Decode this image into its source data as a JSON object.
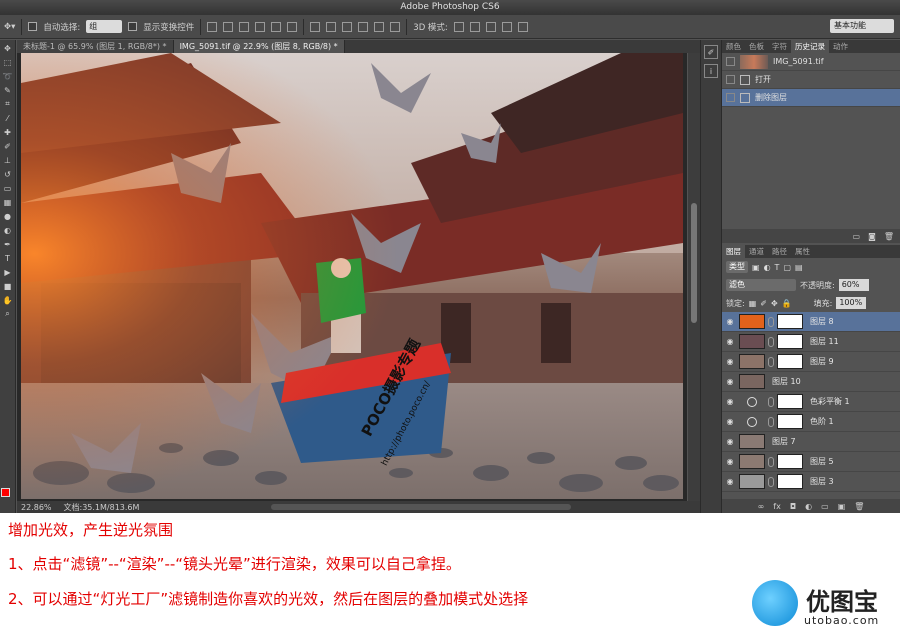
{
  "app": {
    "title": "Adobe Photoshop CS6"
  },
  "options_bar": {
    "auto_select_label": "自动选择:",
    "auto_select_value": "组",
    "show_transform_label": "显示变换控件",
    "mode_3d_label": "3D 模式:",
    "workspace": "基本功能"
  },
  "document_tabs": [
    {
      "label": "未标题-1 @ 65.9% (图层 1, RGB/8*) *",
      "active": false
    },
    {
      "label": "IMG_5091.tif @ 22.9% (图层 8, RGB/8) *",
      "active": true
    }
  ],
  "status": {
    "zoom": "22.86%",
    "doc": "文档:35.1M/813.6M"
  },
  "history_panel": {
    "tabs": [
      "颜色",
      "色板",
      "字符",
      "历史记录",
      "动作"
    ],
    "active_tab": "历史记录",
    "snapshot": "IMG_5091.tif",
    "steps": [
      {
        "label": "打开",
        "selected": false
      },
      {
        "label": "删除图层",
        "selected": true
      }
    ]
  },
  "layers_panel": {
    "tabs": [
      "图层",
      "通道",
      "路径",
      "属性"
    ],
    "active_tab": "图层",
    "filter_kind": "类型",
    "blend_mode": "滤色",
    "opacity_label": "不透明度:",
    "opacity": "60%",
    "lock_label": "锁定:",
    "fill_label": "填充:",
    "fill": "100%",
    "layers": [
      {
        "name": "图层 8",
        "selected": true,
        "thumb": "#e2621c",
        "mask": true,
        "adjustment": false
      },
      {
        "name": "图层 11",
        "selected": false,
        "thumb": "#6a4d52",
        "mask": true,
        "adjustment": false
      },
      {
        "name": "图层 9",
        "selected": false,
        "thumb": "#8c7368",
        "mask": true,
        "adjustment": false
      },
      {
        "name": "图层 10",
        "selected": false,
        "thumb": "#7a6660",
        "mask": false,
        "adjustment": false
      },
      {
        "name": "色彩平衡 1",
        "selected": false,
        "thumb": "",
        "mask": true,
        "adjustment": true
      },
      {
        "name": "色阶 1",
        "selected": false,
        "thumb": "",
        "mask": true,
        "adjustment": true
      },
      {
        "name": "图层 7",
        "selected": false,
        "thumb": "#8a7a74",
        "mask": false,
        "adjustment": false
      },
      {
        "name": "图层 5",
        "selected": false,
        "thumb": "#8c7a72",
        "mask": true,
        "adjustment": false
      },
      {
        "name": "图层 3",
        "selected": false,
        "thumb": "#9a9a9a",
        "mask": true,
        "adjustment": false
      }
    ]
  },
  "tutorial": {
    "line1": "增加光效，产生逆光氛围",
    "line2": "1、点击“滤镜”--“渲染”--“镜头光晕”进行渲染，效果可以自己拿捏。",
    "line3": "2、可以通过“灯光工厂”滤镜制造你喜欢的光效，然后在图层的叠加模式处选择"
  },
  "watermark": {
    "brand": "POCO摄影专题",
    "url": "http://photo.poco.cn/"
  },
  "logo": {
    "name": "优图宝",
    "url": "utobao.com"
  },
  "colors": {
    "foreground": "#ff0000",
    "background": "#ffffff",
    "selection": "#58729a",
    "caption_red": "#e30000"
  }
}
